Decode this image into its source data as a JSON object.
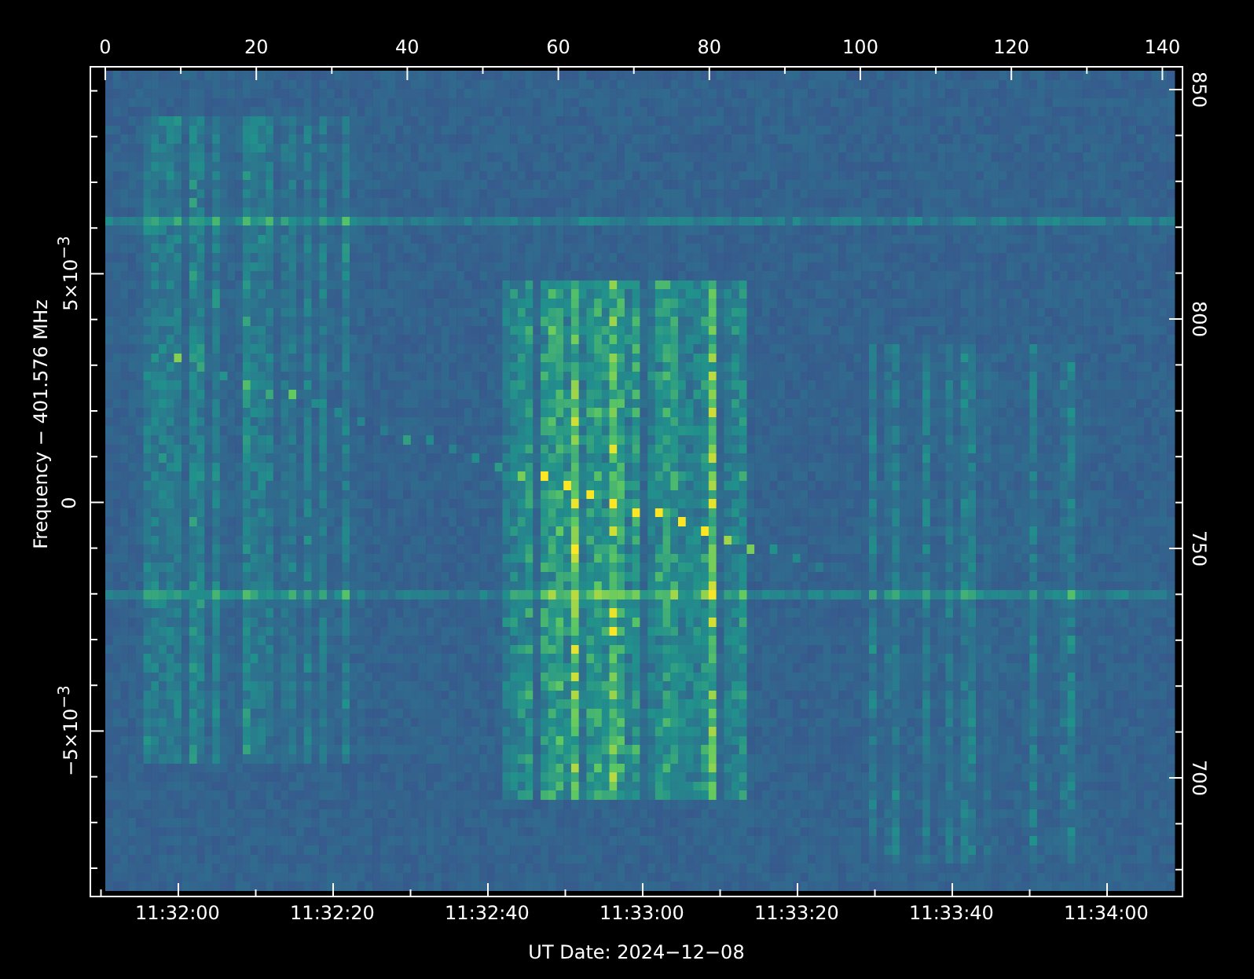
{
  "plot": {
    "top_axis": {
      "tick_labels": [
        "0",
        "20",
        "40",
        "60",
        "80",
        "100",
        "120",
        "140"
      ]
    },
    "right_axis": {
      "tick_labels": [
        "850",
        "800",
        "750",
        "700"
      ]
    },
    "left_axis": {
      "label": "Frequency − 401.576 MHz",
      "tick_labels": [
        "5×10$^{−3}$",
        "0",
        "−5×10$^{−3}$"
      ]
    },
    "bottom_axis": {
      "label": "UT Date: 2024−12−08",
      "tick_labels": [
        "11:32:00",
        "11:32:20",
        "11:32:40",
        "11:33:00",
        "11:33:20",
        "11:33:40",
        "11:34:00"
      ]
    }
  }
}
